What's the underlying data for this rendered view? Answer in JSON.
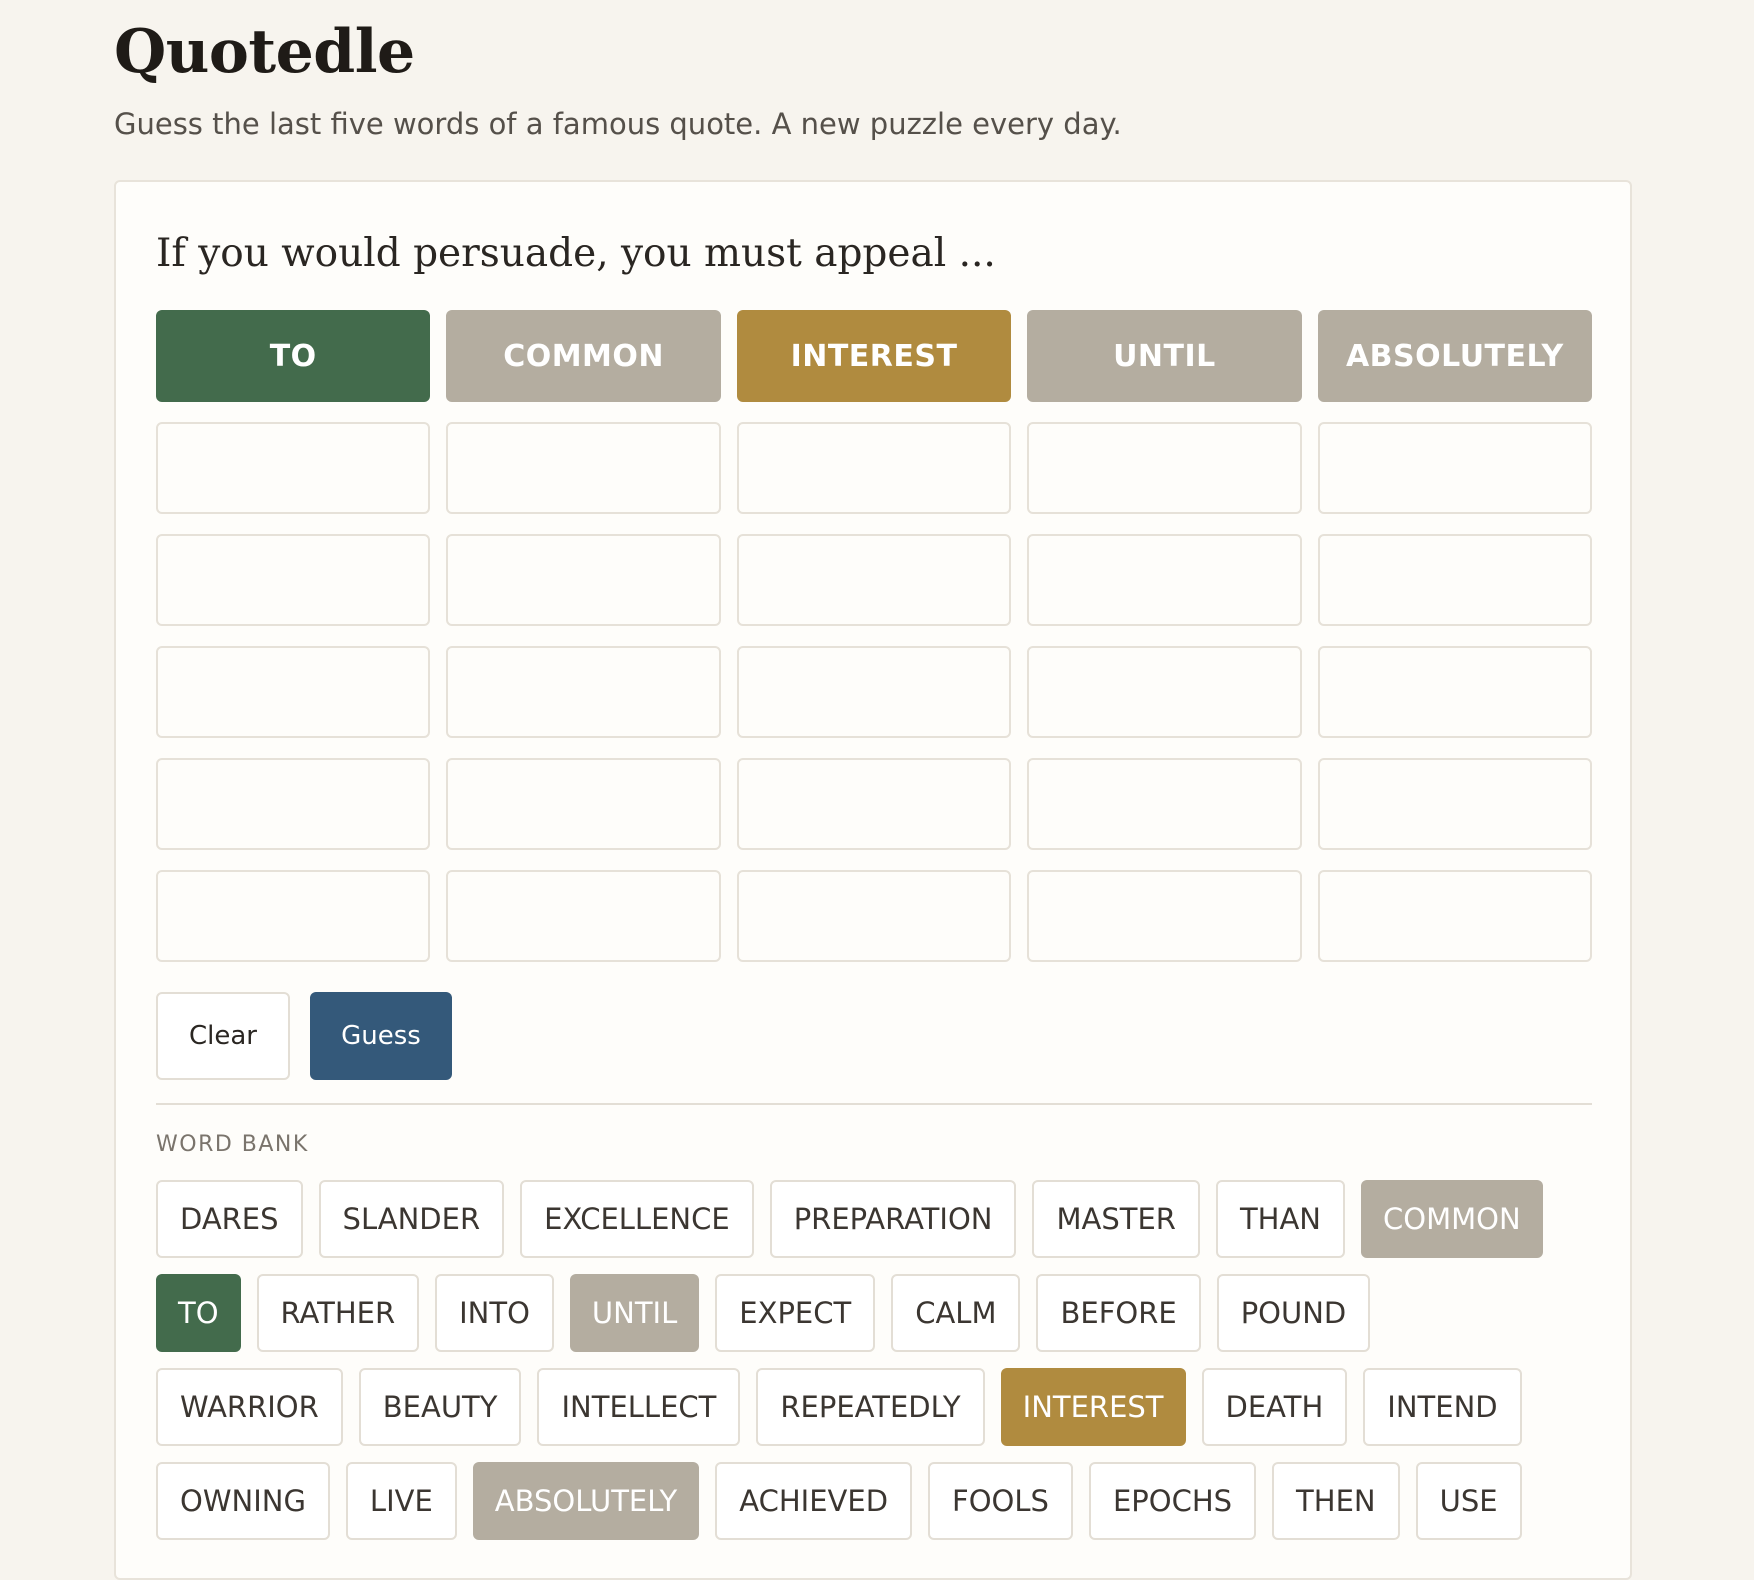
{
  "header": {
    "title": "Quotedle",
    "subtitle": "Guess the last five words of a famous quote. A new puzzle every day."
  },
  "puzzle": {
    "prompt": "If you would persuade, you must appeal ..."
  },
  "colors": {
    "correct": "#436b4c",
    "present": "#b08b3f",
    "absent": "#b4ada0",
    "guess_button": "#34597a"
  },
  "guesses": [
    [
      {
        "word": "TO",
        "state": "correct"
      },
      {
        "word": "COMMON",
        "state": "absent"
      },
      {
        "word": "INTEREST",
        "state": "present"
      },
      {
        "word": "UNTIL",
        "state": "absent"
      },
      {
        "word": "ABSOLUTELY",
        "state": "absent"
      }
    ],
    [
      {
        "word": "",
        "state": "empty"
      },
      {
        "word": "",
        "state": "empty"
      },
      {
        "word": "",
        "state": "empty"
      },
      {
        "word": "",
        "state": "empty"
      },
      {
        "word": "",
        "state": "empty"
      }
    ],
    [
      {
        "word": "",
        "state": "empty"
      },
      {
        "word": "",
        "state": "empty"
      },
      {
        "word": "",
        "state": "empty"
      },
      {
        "word": "",
        "state": "empty"
      },
      {
        "word": "",
        "state": "empty"
      }
    ],
    [
      {
        "word": "",
        "state": "empty"
      },
      {
        "word": "",
        "state": "empty"
      },
      {
        "word": "",
        "state": "empty"
      },
      {
        "word": "",
        "state": "empty"
      },
      {
        "word": "",
        "state": "empty"
      }
    ],
    [
      {
        "word": "",
        "state": "empty"
      },
      {
        "word": "",
        "state": "empty"
      },
      {
        "word": "",
        "state": "empty"
      },
      {
        "word": "",
        "state": "empty"
      },
      {
        "word": "",
        "state": "empty"
      }
    ],
    [
      {
        "word": "",
        "state": "empty"
      },
      {
        "word": "",
        "state": "empty"
      },
      {
        "word": "",
        "state": "empty"
      },
      {
        "word": "",
        "state": "empty"
      },
      {
        "word": "",
        "state": "empty"
      }
    ]
  ],
  "actions": {
    "clear_label": "Clear",
    "guess_label": "Guess"
  },
  "word_bank": {
    "label": "WORD BANK",
    "rows": [
      [
        {
          "word": "DARES",
          "state": "none"
        },
        {
          "word": "SLANDER",
          "state": "none"
        },
        {
          "word": "EXCELLENCE",
          "state": "none"
        },
        {
          "word": "PREPARATION",
          "state": "none"
        },
        {
          "word": "MASTER",
          "state": "none"
        },
        {
          "word": "THAN",
          "state": "none"
        },
        {
          "word": "COMMON",
          "state": "absent"
        }
      ],
      [
        {
          "word": "TO",
          "state": "correct"
        },
        {
          "word": "RATHER",
          "state": "none"
        },
        {
          "word": "INTO",
          "state": "none"
        },
        {
          "word": "UNTIL",
          "state": "absent"
        },
        {
          "word": "EXPECT",
          "state": "none"
        },
        {
          "word": "CALM",
          "state": "none"
        },
        {
          "word": "BEFORE",
          "state": "none"
        },
        {
          "word": "POUND",
          "state": "none"
        }
      ],
      [
        {
          "word": "WARRIOR",
          "state": "none"
        },
        {
          "word": "BEAUTY",
          "state": "none"
        },
        {
          "word": "INTELLECT",
          "state": "none"
        },
        {
          "word": "REPEATEDLY",
          "state": "none"
        },
        {
          "word": "INTEREST",
          "state": "present"
        },
        {
          "word": "DEATH",
          "state": "none"
        },
        {
          "word": "INTEND",
          "state": "none"
        }
      ],
      [
        {
          "word": "OWNING",
          "state": "none"
        },
        {
          "word": "LIVE",
          "state": "none"
        },
        {
          "word": "ABSOLUTELY",
          "state": "absent"
        },
        {
          "word": "ACHIEVED",
          "state": "none"
        },
        {
          "word": "FOOLS",
          "state": "none"
        },
        {
          "word": "EPOCHS",
          "state": "none"
        },
        {
          "word": "THEN",
          "state": "none"
        },
        {
          "word": "USE",
          "state": "none"
        }
      ]
    ]
  }
}
